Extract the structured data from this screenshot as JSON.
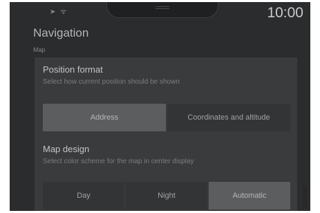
{
  "status": {
    "icons": [
      "location-arrow-icon",
      "wifi-icon"
    ],
    "time": "10:00"
  },
  "header": {
    "title": "Navigation",
    "breadcrumb": "Map"
  },
  "position_format": {
    "title": "Position format",
    "description": "Select how current position should be shown",
    "options": [
      "Address",
      "Coordinates and altitude"
    ],
    "selected": "Address"
  },
  "map_design": {
    "title": "Map design",
    "description": "Select color scheme for the map in center display",
    "options": [
      "Day",
      "Night",
      "Automatic"
    ],
    "selected": "Automatic"
  },
  "image_code": "G054007"
}
